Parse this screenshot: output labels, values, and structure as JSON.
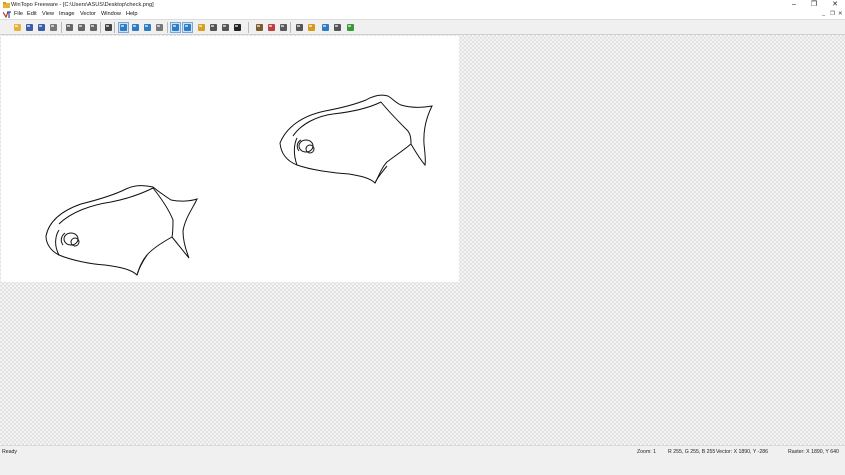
{
  "window": {
    "title": "WinTopo Freeware - [C:\\Users\\ASUS\\Desktop\\check.png]",
    "minimize": "–",
    "maximize": "❐",
    "close": "✕"
  },
  "menu": {
    "items": [
      "File",
      "Edit",
      "View",
      "Image",
      "Vector",
      "Window",
      "Help"
    ],
    "doc_minimize": "_",
    "doc_restore": "❐",
    "doc_close": "✕"
  },
  "toolbar": {
    "buttons": [
      {
        "name": "open-icon",
        "color": "#e7b23a"
      },
      {
        "name": "save-icon",
        "color": "#3b5ea8"
      },
      {
        "name": "save-vector-icon",
        "color": "#3b5ea8"
      },
      {
        "name": "print-icon",
        "color": "#777777"
      },
      {
        "name": "cut-icon",
        "color": "#666666"
      },
      {
        "name": "copy-icon",
        "color": "#666666"
      },
      {
        "name": "paste-icon",
        "color": "#666666"
      },
      {
        "name": "undo-icon",
        "color": "#444444"
      },
      {
        "name": "zoom-icon",
        "color": "#2f7cc4",
        "active": true
      },
      {
        "name": "zoom-in-icon",
        "color": "#2f7cc4"
      },
      {
        "name": "zoom-out-icon",
        "color": "#2f7cc4"
      },
      {
        "name": "pan-icon",
        "color": "#777777"
      },
      {
        "name": "select-raster-icon",
        "color": "#2f7cc4",
        "active": true
      },
      {
        "name": "select-vector-icon",
        "color": "#2f7cc4",
        "active": true
      },
      {
        "name": "pencil-icon",
        "color": "#d4a020"
      },
      {
        "name": "draw-icon",
        "color": "#555555"
      },
      {
        "name": "edit-vector-icon",
        "color": "#555555"
      },
      {
        "name": "crop-icon",
        "color": "#222222"
      },
      {
        "name": "image-tool-1-icon",
        "color": "#7a5c2e"
      },
      {
        "name": "image-tool-2-icon",
        "color": "#c04040"
      },
      {
        "name": "image-tool-3-icon",
        "color": "#5a5a5a"
      },
      {
        "name": "thinning-icon",
        "color": "#555555"
      },
      {
        "name": "thin-color-icon",
        "color": "#d49a20"
      },
      {
        "name": "vectorize-icon",
        "color": "#2f7cc4"
      },
      {
        "name": "vector-tool-icon",
        "color": "#555555"
      },
      {
        "name": "one-touch-vectorise-icon",
        "color": "#3a9a3a"
      }
    ]
  },
  "status": {
    "ready": "Ready",
    "zoom": "Zoom: 1",
    "rgb": "R 255, G 255, B 255",
    "vector": "Vector: X 1890, Y -286",
    "raster": "Raster: X 1890, Y 640"
  }
}
